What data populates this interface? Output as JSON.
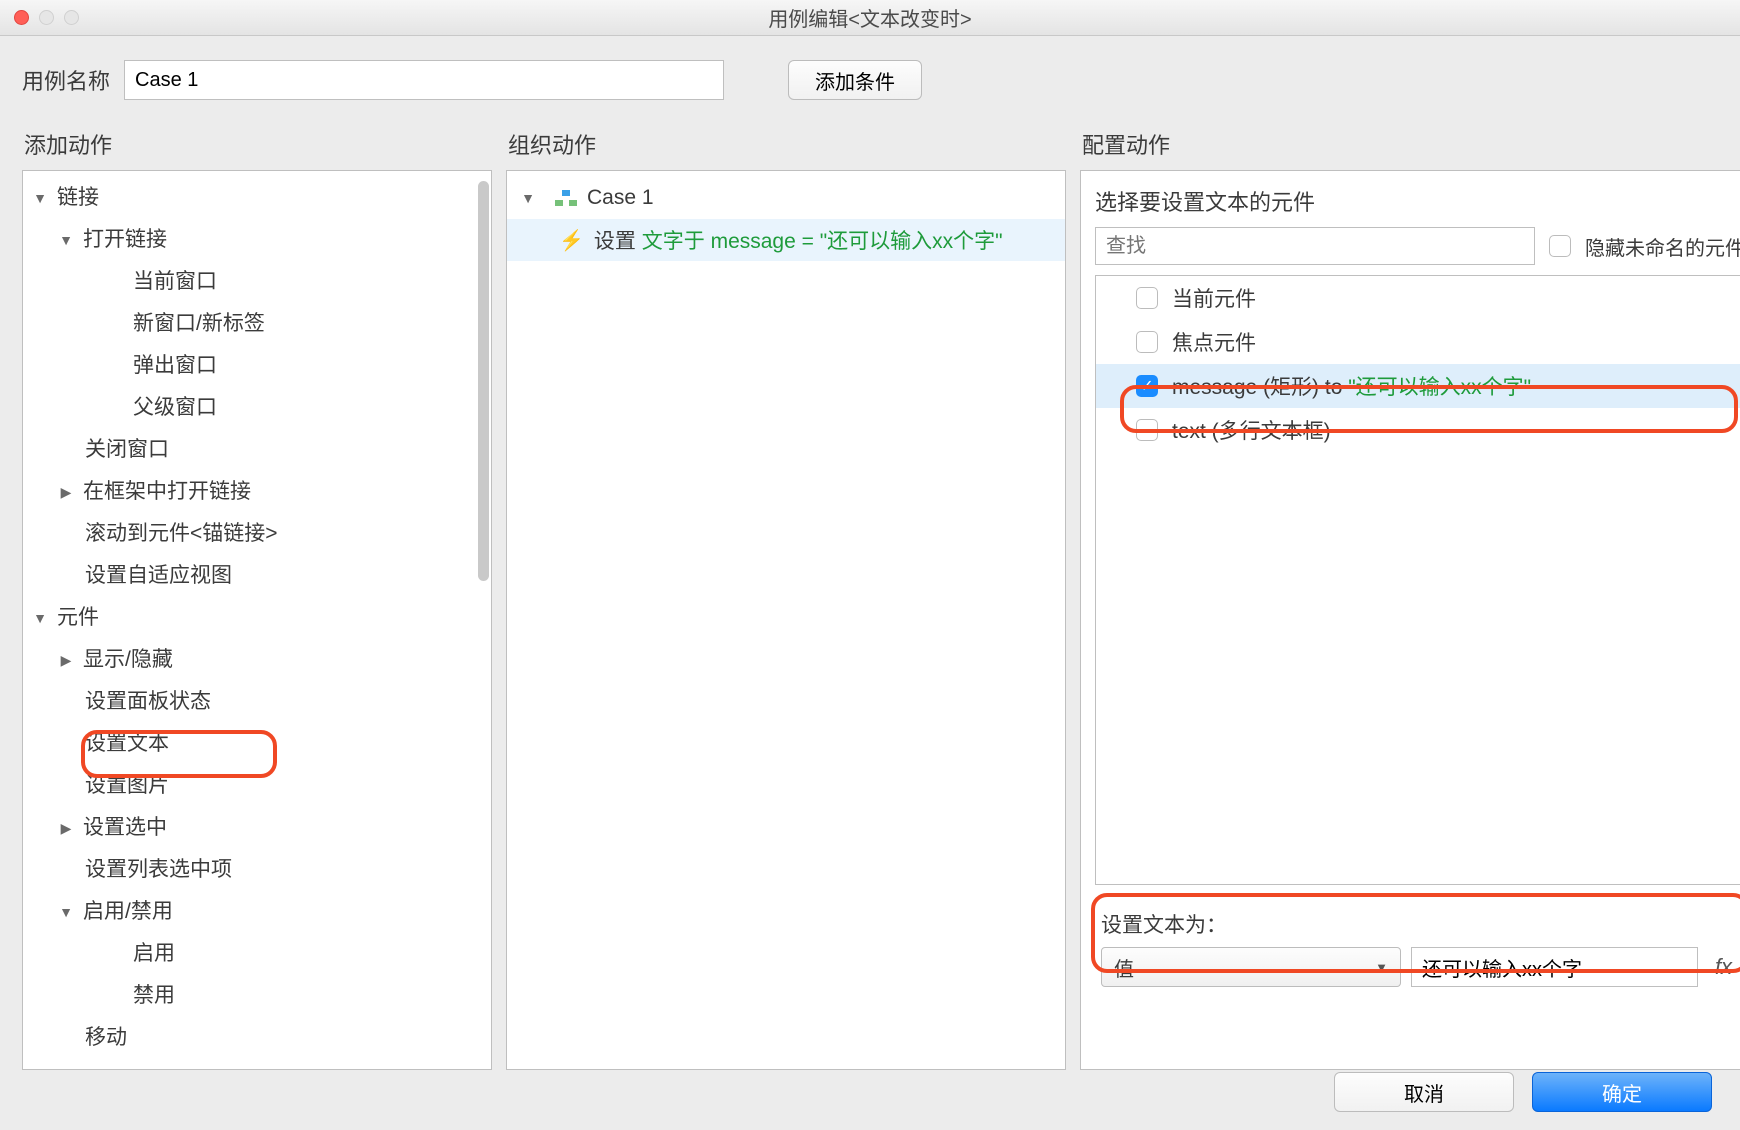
{
  "window": {
    "title": "用例编辑<文本改变时>"
  },
  "header": {
    "caseNameLabel": "用例名称",
    "caseNameValue": "Case 1",
    "addCondition": "添加条件"
  },
  "sections": {
    "addAction": "添加动作",
    "organize": "组织动作",
    "configure": "配置动作"
  },
  "tree": {
    "links": "链接",
    "openLink": "打开链接",
    "currentWindow": "当前窗口",
    "newWindowTab": "新窗口/新标签",
    "popup": "弹出窗口",
    "parent": "父级窗口",
    "closeWindow": "关闭窗口",
    "openInFrame": "在框架中打开链接",
    "scrollToAnchor": "滚动到元件<锚链接>",
    "setAdaptive": "设置自适应视图",
    "widgets": "元件",
    "showHide": "显示/隐藏",
    "setPanelState": "设置面板状态",
    "setText": "设置文本",
    "setImage": "设置图片",
    "setSelected": "设置选中",
    "setListSelected": "设置列表选中项",
    "enableDisable": "启用/禁用",
    "enable": "启用",
    "disable": "禁用",
    "move": "移动"
  },
  "organize": {
    "caseName": "Case 1",
    "setPrefix": "设置",
    "setDetail": " 文字于 message = \"还可以输入xx个字\""
  },
  "config": {
    "selectWidgetLabel": "选择要设置文本的元件",
    "searchPlaceholder": "查找",
    "hideUnnamed": "隐藏未命名的元件",
    "items": {
      "current": "当前元件",
      "focus": "焦点元件",
      "messagePrefix": "message (矩形) to ",
      "messageValue": "\"还可以输入xx个字\"",
      "text": "text (多行文本框)"
    },
    "setTextTo": "设置文本为：",
    "selectValue": "值",
    "inputValue": "还可以输入xx个字",
    "fx": "fx"
  },
  "footer": {
    "cancel": "取消",
    "ok": "确定"
  }
}
